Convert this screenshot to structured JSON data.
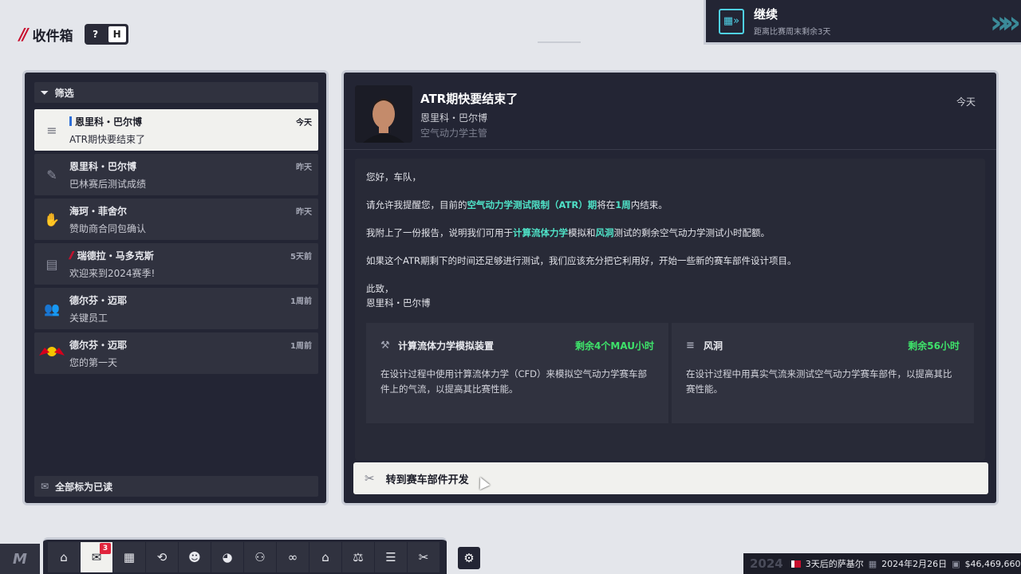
{
  "header": {
    "title": "收件箱",
    "help_key": "?",
    "hotkey": "H"
  },
  "continue": {
    "label": "继续",
    "sub": "距离比赛周末剩余3天"
  },
  "filter": {
    "label": "筛选"
  },
  "messages": [
    {
      "sender": "恩里科・巴尔博",
      "subject": "ATR期快要结束了",
      "date": "今天",
      "icon": "wind-tunnel-icon"
    },
    {
      "sender": "恩里科・巴尔博",
      "subject": "巴林赛后测试成绩",
      "date": "昨天",
      "icon": "wrench-icon"
    },
    {
      "sender": "海珂・菲舍尔",
      "subject": "赞助商合同包确认",
      "date": "昨天",
      "icon": "handshake-icon"
    },
    {
      "sender": "瑞德拉・马多克斯",
      "subject": "欢迎来到2024赛季!",
      "date": "5天前",
      "icon": "document-icon"
    },
    {
      "sender": "德尔芬・迈耶",
      "subject": "关键员工",
      "date": "1周前",
      "icon": "staff-icon"
    },
    {
      "sender": "德尔芬・迈耶",
      "subject": "您的第一天",
      "date": "1周前",
      "icon": "red-bull-logo"
    }
  ],
  "mark_all_read": "全部标为已读",
  "detail": {
    "title": "ATR期快要结束了",
    "sender": "恩里科・巴尔博",
    "role": "空气动力学主管",
    "date": "今天",
    "greeting": "您好，车队，",
    "p1_a": "请允许我提醒您，目前的",
    "p1_hl1": "空气动力学测试限制（ATR）期",
    "p1_b": "将在",
    "p1_hl2": "1周",
    "p1_c": "内结束。",
    "p2_a": "我附上了一份报告，说明我们可用于",
    "p2_hl1": "计算流体力学",
    "p2_b": "模拟和",
    "p2_hl2": "风洞",
    "p2_c": "测试的剩余空气动力学测试小时配额。",
    "p3": "如果这个ATR期剩下的时间还足够进行测试，我们应该充分把它利用好，开始一些新的赛车部件设计项目。",
    "sign1": "此致，",
    "sign2": "恩里科・巴尔博",
    "cards": [
      {
        "name": "计算流体力学模拟装置",
        "remaining": "剩余4个MAU小时",
        "desc": "在设计过程中使用计算流体力学（CFD）来模拟空气动力学赛车部件上的气流，以提高其比赛性能。"
      },
      {
        "name": "风洞",
        "remaining": "剩余56小时",
        "desc": "在设计过程中用真实气流来测试空气动力学赛车部件，以提高其比赛性能。"
      }
    ],
    "action": "转到赛车部件开发"
  },
  "dock": {
    "mail_badge": "3"
  },
  "status": {
    "year": "2024",
    "race": "3天后的萨基尔",
    "date": "2024年2月26日",
    "money": "$46,469,660"
  },
  "colors": {
    "accent": "#4fe3c8",
    "remaining": "#3ee26a",
    "panel": "#232534",
    "badge": "#e0243c"
  }
}
